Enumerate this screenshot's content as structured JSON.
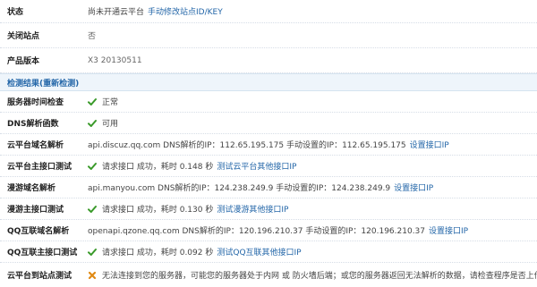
{
  "rows": {
    "status": {
      "label": "状态",
      "value": "尚未开通云平台",
      "link": "手动修改站点ID/KEY"
    },
    "close_site": {
      "label": "关闭站点",
      "value": "否"
    },
    "version": {
      "label": "产品版本",
      "value": "X3 20130511"
    }
  },
  "section": {
    "title": "检测结果(重新检测)"
  },
  "checks": {
    "server_time": {
      "label": "服务器时间检查",
      "result": "正常"
    },
    "dns_func": {
      "label": "DNS解析函数",
      "result": "可用"
    },
    "cloud_dns": {
      "label": "云平台域名解析",
      "text": "api.discuz.qq.com DNS解析的IP：112.65.195.175 手动设置的IP：112.65.195.175",
      "link": "设置接口IP"
    },
    "cloud_test": {
      "label": "云平台主接口测试",
      "text": "请求接口 成功，耗时 0.148 秒",
      "link": "测试云平台其他接口IP"
    },
    "manyou_dns": {
      "label": "漫游域名解析",
      "text": "api.manyou.com DNS解析的IP：124.238.249.9 手动设置的IP：124.238.249.9",
      "link": "设置接口IP"
    },
    "manyou_test": {
      "label": "漫游主接口测试",
      "text": "请求接口 成功，耗时 0.130 秒",
      "link": "测试漫游其他接口IP"
    },
    "qq_dns": {
      "label": "QQ互联域名解析",
      "text": "openapi.qzone.qq.com DNS解析的IP：120.196.210.37 手动设置的IP：120.196.210.37",
      "link": "设置接口IP"
    },
    "qq_test": {
      "label": "QQ互联主接口测试",
      "text": "请求接口 成功，耗时 0.092 秒",
      "link": "测试QQ互联其他接口IP"
    },
    "cloud_to_site": {
      "label": "云平台到站点测试",
      "text": "无法连接到您的服务器，可能您的服务器处于内网 或 防火墙后端；或您的服务器返回无法解析的数据，请检查程序是否上传完整"
    }
  },
  "colors": {
    "ok": "#3a9a2a",
    "error": "#e08a14",
    "link": "#2366a8"
  }
}
